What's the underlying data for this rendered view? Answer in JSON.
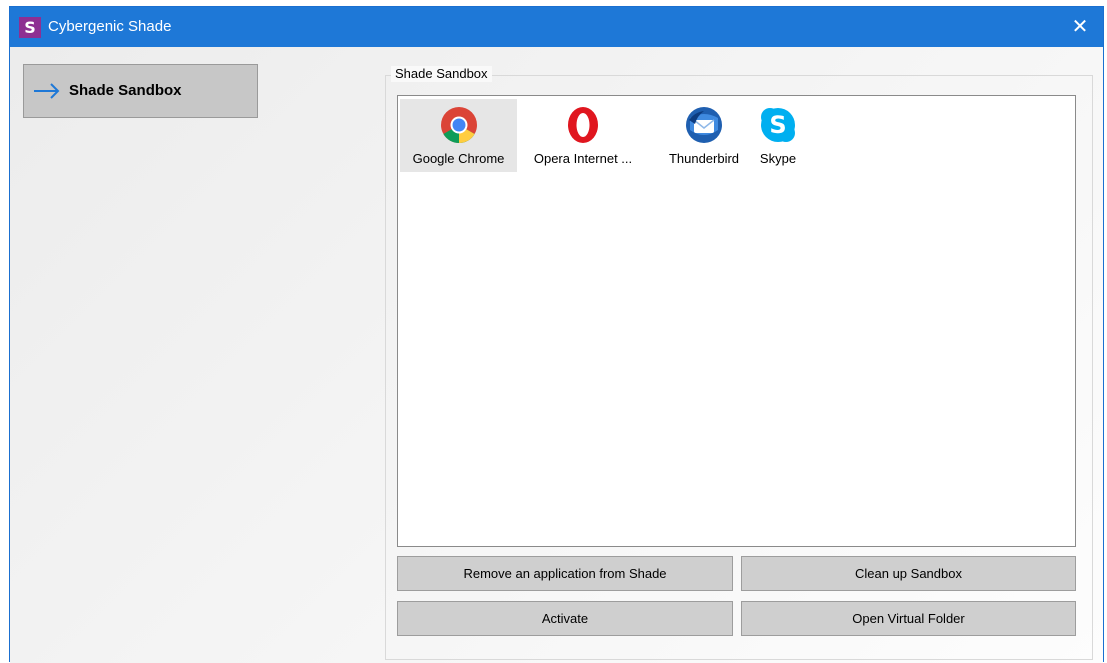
{
  "window": {
    "title": "Cybergenic Shade",
    "logo_letter": "S",
    "close_glyph": "✕"
  },
  "colors": {
    "titlebar": "#1e78d7",
    "logo": "#8e2f92",
    "nav_selected": "#c7c7c7",
    "button": "#cfcfcf",
    "arrow": "#1e78d7"
  },
  "sidebar": {
    "items": [
      {
        "label": "Shade Sandbox",
        "icon": "arrow-right-icon",
        "selected": true
      }
    ]
  },
  "main": {
    "group_title": "Shade Sandbox",
    "apps": [
      {
        "label": "Google Chrome",
        "icon": "chrome-icon",
        "selected": true
      },
      {
        "label": "Opera Internet ...",
        "icon": "opera-icon",
        "selected": false
      },
      {
        "label": "Thunderbird",
        "icon": "thunderbird-icon",
        "selected": false
      },
      {
        "label": "Skype",
        "icon": "skype-icon",
        "selected": false
      }
    ],
    "buttons": {
      "remove": "Remove an application from Shade",
      "cleanup": "Clean up Sandbox",
      "activate": "Activate",
      "open_folder": "Open Virtual Folder"
    }
  }
}
